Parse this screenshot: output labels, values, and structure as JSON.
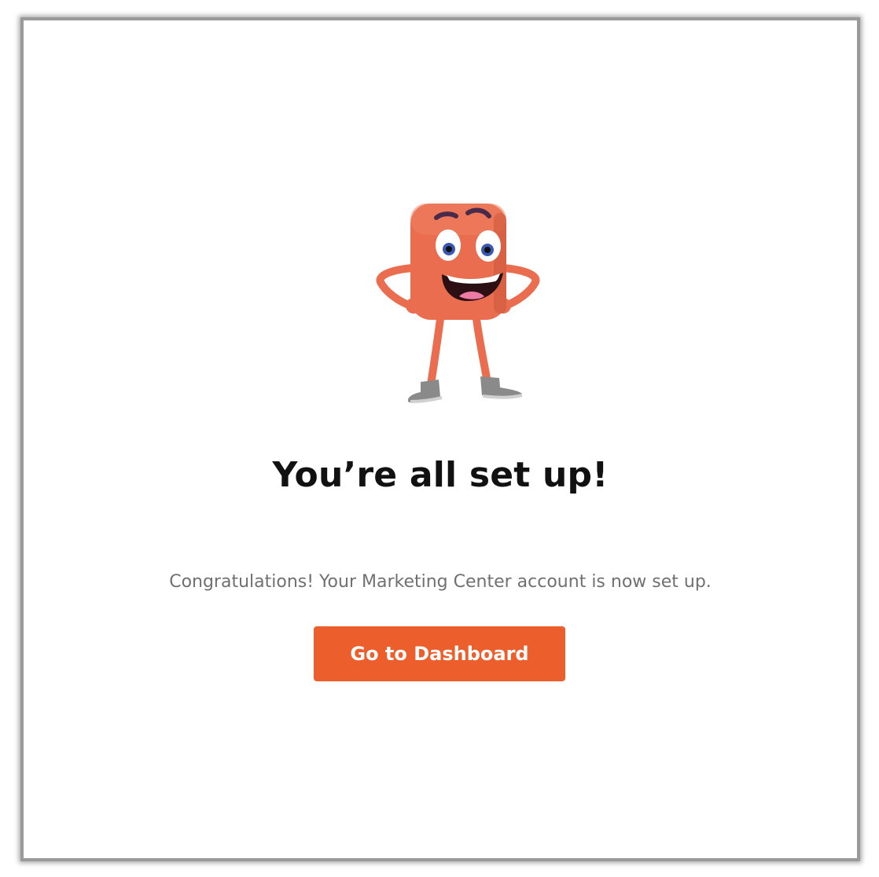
{
  "dialog": {
    "title": "You’re all set up!",
    "message": "Congratulations! Your Marketing Center account is now set up.",
    "primary_button_label": "Go to Dashboard"
  },
  "colors": {
    "accent": "#ec5f2d",
    "title_text": "#111111",
    "body_text": "#707070"
  },
  "icons": {
    "mascot": "smiling-orange-block-mascot-icon"
  }
}
